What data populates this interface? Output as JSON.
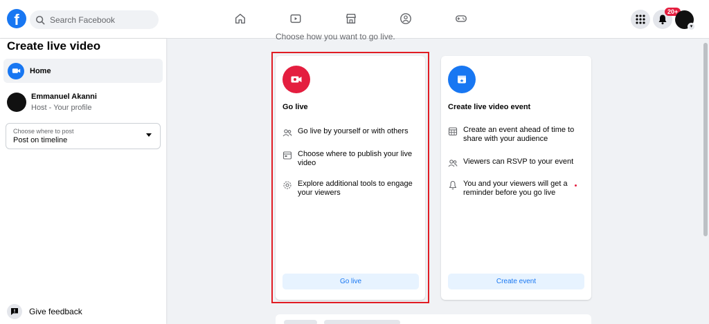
{
  "topbar": {
    "logo": "f",
    "search_placeholder": "Search Facebook",
    "nav_icons": [
      "home-icon",
      "watch-icon",
      "marketplace-icon",
      "groups-icon",
      "gaming-icon"
    ],
    "menu_icon": "grid-menu-icon",
    "notifications_icon": "bell-icon",
    "notification_count": "20+"
  },
  "sidebar": {
    "title": "Create live video",
    "home_label": "Home",
    "profile_name": "Emmanuel Akanni",
    "profile_role": "Host - Your profile",
    "post_select_caption": "Choose where to post",
    "post_select_value": "Post on timeline",
    "feedback_label": "Give feedback"
  },
  "main": {
    "instruction": "Choose how you want to go live.",
    "go_live_card": {
      "title": "Go live",
      "features": [
        "Go live by yourself or with others",
        "Choose where to publish your live video",
        "Explore additional tools to engage your viewers"
      ],
      "button": "Go live"
    },
    "event_card": {
      "title": "Create live video event",
      "features": [
        "Create an event ahead of time to share with your audience",
        "Viewers can RSVP to your event",
        "You and your viewers will get a reminder before you go live"
      ],
      "button": "Create event"
    }
  },
  "colors": {
    "brand": "#1877f2",
    "go_live_icon": "#e41e3f",
    "highlight": "#e11c23"
  }
}
